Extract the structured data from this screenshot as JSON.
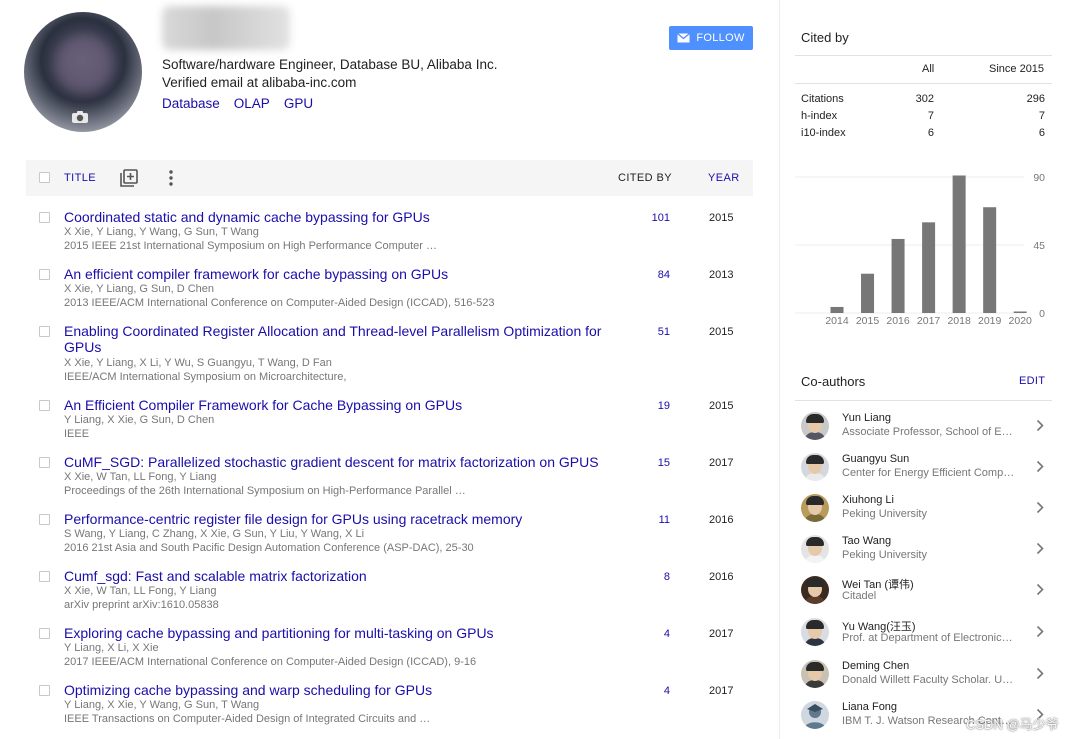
{
  "profile": {
    "affiliation": "Software/hardware Engineer, Database BU, Alibaba Inc.",
    "verified": "Verified email at alibaba-inc.com",
    "interests": [
      "Database",
      "OLAP",
      "GPU"
    ],
    "follow_label": "FOLLOW"
  },
  "table": {
    "header_title": "TITLE",
    "header_cited": "CITED BY",
    "header_year": "YEAR",
    "articles": [
      {
        "title": "Coordinated static and dynamic cache bypassing for GPUs",
        "authors": "X Xie, Y Liang, Y Wang, G Sun, T Wang",
        "venue": "2015 IEEE 21st International Symposium on High Performance Computer …",
        "cited": "101",
        "year": "2015"
      },
      {
        "title": "An efficient compiler framework for cache bypassing on GPUs",
        "authors": "X Xie, Y Liang, G Sun, D Chen",
        "venue": "2013 IEEE/ACM International Conference on Computer-Aided Design (ICCAD), 516-523",
        "cited": "84",
        "year": "2013"
      },
      {
        "title": "Enabling Coordinated Register Allocation and Thread-level Parallelism Optimization for GPUs",
        "authors": "X Xie, Y Liang, X Li, Y Wu, S Guangyu, T Wang, D Fan",
        "venue": "IEEE/ACM International Symposium on Microarchitecture,",
        "cited": "51",
        "year": "2015"
      },
      {
        "title": "An Efficient Compiler Framework for Cache Bypassing on GPUs",
        "authors": "Y Liang, X Xie, G Sun, D Chen",
        "venue": "IEEE",
        "cited": "19",
        "year": "2015"
      },
      {
        "title": "CuMF_SGD: Parallelized stochastic gradient descent for matrix factorization on GPUS",
        "authors": "X Xie, W Tan, LL Fong, Y Liang",
        "venue": "Proceedings of the 26th International Symposium on High-Performance Parallel …",
        "cited": "15",
        "year": "2017"
      },
      {
        "title": "Performance-centric register file design for GPUs using racetrack memory",
        "authors": "S Wang, Y Liang, C Zhang, X Xie, G Sun, Y Liu, Y Wang, X Li",
        "venue": "2016 21st Asia and South Pacific Design Automation Conference (ASP-DAC), 25-30",
        "cited": "11",
        "year": "2016"
      },
      {
        "title": "Cumf_sgd: Fast and scalable matrix factorization",
        "authors": "X Xie, W Tan, LL Fong, Y Liang",
        "venue": "arXiv preprint arXiv:1610.05838",
        "cited": "8",
        "year": "2016"
      },
      {
        "title": "Exploring cache bypassing and partitioning for multi-tasking on GPUs",
        "authors": "Y Liang, X Li, X Xie",
        "venue": "2017 IEEE/ACM International Conference on Computer-Aided Design (ICCAD), 9-16",
        "cited": "4",
        "year": "2017"
      },
      {
        "title": "Optimizing cache bypassing and warp scheduling for GPUs",
        "authors": "Y Liang, X Xie, Y Wang, G Sun, T Wang",
        "venue": "IEEE Transactions on Computer-Aided Design of Integrated Circuits and …",
        "cited": "4",
        "year": "2017"
      }
    ]
  },
  "cited_by": {
    "title": "Cited by",
    "col_all": "All",
    "col_since": "Since 2015",
    "metrics": [
      {
        "label": "Citations",
        "all": "302",
        "since": "296"
      },
      {
        "label": "h-index",
        "all": "7",
        "since": "7"
      },
      {
        "label": "i10-index",
        "all": "6",
        "since": "6"
      }
    ]
  },
  "chart_data": {
    "type": "bar",
    "categories": [
      "2014",
      "2015",
      "2016",
      "2017",
      "2018",
      "2019",
      "2020"
    ],
    "values": [
      4,
      26,
      49,
      60,
      91,
      70,
      1
    ],
    "yticks": [
      0,
      45,
      90
    ],
    "ylim": [
      0,
      90
    ],
    "bar_color": "#777777"
  },
  "coauthors": {
    "title": "Co-authors",
    "edit_label": "EDIT",
    "list": [
      {
        "name": "Yun Liang",
        "affiliation": "Associate Professor, School of E…"
      },
      {
        "name": "Guangyu Sun",
        "affiliation": "Center for Energy Efficient Comp…"
      },
      {
        "name": "Xiuhong Li",
        "affiliation": "Peking University"
      },
      {
        "name": "Tao Wang",
        "affiliation": "Peking University"
      },
      {
        "name": "Wei Tan (谭伟)",
        "affiliation": "Citadel"
      },
      {
        "name": "Yu Wang(汪玉)",
        "affiliation": "Prof. at Department of Electronic…"
      },
      {
        "name": "Deming Chen",
        "affiliation": "Donald Willett Faculty Scholar. U…"
      },
      {
        "name": "Liana Fong",
        "affiliation": "IBM T. J. Watson Research Cente…"
      }
    ]
  },
  "watermark": "CSDN @马少爷",
  "colors": {
    "link": "#1a0dab",
    "follow": "#4d90fe",
    "bar": "#777777"
  }
}
